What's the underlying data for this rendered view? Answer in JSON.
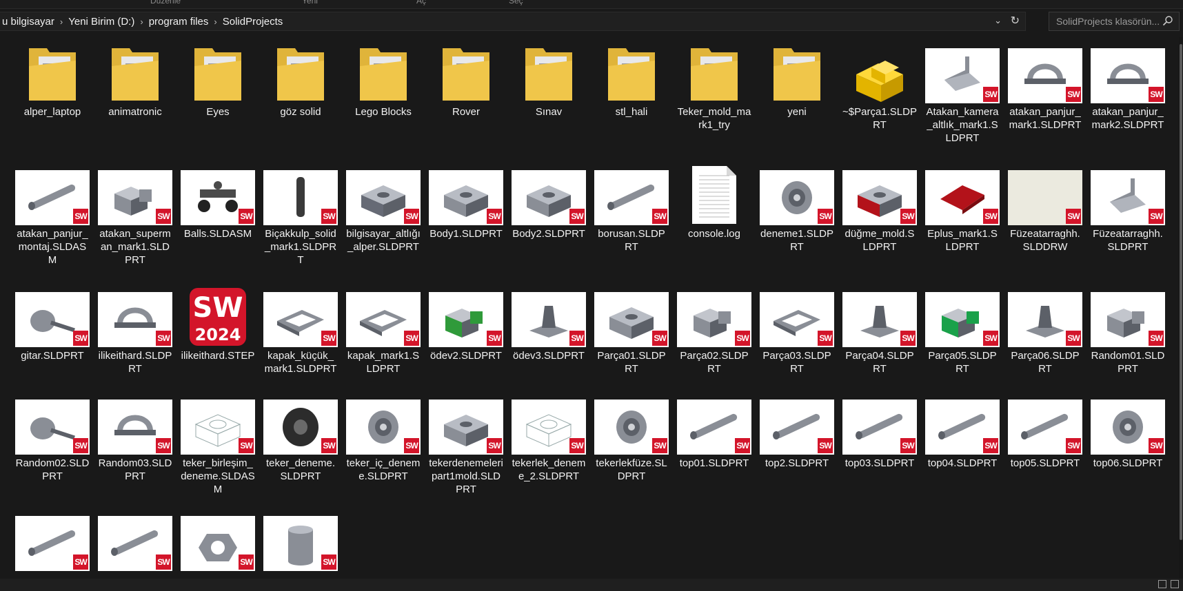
{
  "ribbon": {
    "labels": [
      "Düzenle",
      "Yeni",
      "Aç",
      "Seç"
    ]
  },
  "breadcrumb": [
    "u bilgisayar",
    "Yeni Birim (D:)",
    "program files",
    "SolidProjects"
  ],
  "search": {
    "placeholder": "SolidProjects klasörün..."
  },
  "items": [
    {
      "name": "alper_laptop",
      "kind": "folder"
    },
    {
      "name": "animatronic",
      "kind": "folder"
    },
    {
      "name": "Eyes",
      "kind": "folder"
    },
    {
      "name": "göz solid",
      "kind": "folder"
    },
    {
      "name": "Lego Blocks",
      "kind": "folder"
    },
    {
      "name": "Rover",
      "kind": "folder"
    },
    {
      "name": "Sınav",
      "kind": "folder"
    },
    {
      "name": "stl_hali",
      "kind": "folder"
    },
    {
      "name": "Teker_mold_mark1_try",
      "kind": "folder"
    },
    {
      "name": "yeni",
      "kind": "folder"
    },
    {
      "name": "~$Parça1.SLDPRT",
      "kind": "ghost"
    },
    {
      "name": "Atakan_kamera_altlık_mark1.SLDPRT",
      "kind": "sw",
      "shape": "bracket"
    },
    {
      "name": "atakan_panjur_mark1.SLDPRT",
      "kind": "sw",
      "shape": "clamp"
    },
    {
      "name": "atakan_panjur_mark2.SLDPRT",
      "kind": "sw",
      "shape": "clamp"
    },
    {
      "name": "atakan_panjur_montaj.SLDASM",
      "kind": "sw",
      "shape": "rod"
    },
    {
      "name": "atakan_superman_mark1.SLDPRT",
      "kind": "sw",
      "shape": "block"
    },
    {
      "name": "Balls.SLDASM",
      "kind": "sw",
      "shape": "cart",
      "color": "#4a4a4a"
    },
    {
      "name": "Biçakkulp_solid_mark1.SLDPRT",
      "kind": "sw",
      "shape": "handle",
      "color": "#3a3a3a"
    },
    {
      "name": "bilgisayar_altlığı_alper.SLDPRT",
      "kind": "sw",
      "shape": "box",
      "color": "#666a75"
    },
    {
      "name": "Body1.SLDPRT",
      "kind": "sw",
      "shape": "box"
    },
    {
      "name": "Body2.SLDPRT",
      "kind": "sw",
      "shape": "box"
    },
    {
      "name": "borusan.SLDPRT",
      "kind": "sw",
      "shape": "rod"
    },
    {
      "name": "console.log",
      "kind": "text"
    },
    {
      "name": "deneme1.SLDPRT",
      "kind": "sw",
      "shape": "wheel"
    },
    {
      "name": "düğme_mold.SLDPRT",
      "kind": "sw",
      "shape": "box",
      "color": "#b3121a"
    },
    {
      "name": "Eplus_mark1.SLDPRT",
      "kind": "sw",
      "shape": "diamond",
      "color": "#b3121a"
    },
    {
      "name": "Füzeatarraghh.SLDDRW",
      "kind": "sw",
      "shape": "none",
      "drw": true
    },
    {
      "name": "Füzeatarraghh.SLDPRT",
      "kind": "sw",
      "shape": "bracket"
    },
    {
      "name": "gitar.SLDPRT",
      "kind": "sw",
      "shape": "guitar"
    },
    {
      "name": "ilikeithard.SLDPRT",
      "kind": "sw",
      "shape": "clamp"
    },
    {
      "name": "ilikeithard.STEP",
      "kind": "step",
      "badge_main": "SW",
      "badge_year": "2024"
    },
    {
      "name": "kapak_küçük_mark1.SLDPRT",
      "kind": "sw",
      "shape": "frame"
    },
    {
      "name": "kapak_mark1.SLDPRT",
      "kind": "sw",
      "shape": "frame"
    },
    {
      "name": "ödev2.SLDPRT",
      "kind": "sw",
      "shape": "block",
      "color": "#2f9a3a"
    },
    {
      "name": "ödev3.SLDPRT",
      "kind": "sw",
      "shape": "cone"
    },
    {
      "name": "Parça01.SLDPRT",
      "kind": "sw",
      "shape": "box"
    },
    {
      "name": "Parça02.SLDPRT",
      "kind": "sw",
      "shape": "block"
    },
    {
      "name": "Parça03.SLDPRT",
      "kind": "sw",
      "shape": "frame"
    },
    {
      "name": "Parça04.SLDPRT",
      "kind": "sw",
      "shape": "cone"
    },
    {
      "name": "Parça05.SLDPRT",
      "kind": "sw",
      "shape": "block",
      "color": "#1aa14a"
    },
    {
      "name": "Parça06.SLDPRT",
      "kind": "sw",
      "shape": "cone"
    },
    {
      "name": "Random01.SLDPRT",
      "kind": "sw",
      "shape": "block"
    },
    {
      "name": "Random02.SLDPRT",
      "kind": "sw",
      "shape": "guitar"
    },
    {
      "name": "Random03.SLDPRT",
      "kind": "sw",
      "shape": "clamp"
    },
    {
      "name": "teker_birleşim_deneme.SLDASM",
      "kind": "sw",
      "shape": "wire"
    },
    {
      "name": "teker_deneme.SLDPRT",
      "kind": "sw",
      "shape": "tire",
      "color": "#2c2c2c"
    },
    {
      "name": "teker_iç_deneme.SLDPRT",
      "kind": "sw",
      "shape": "wheel"
    },
    {
      "name": "tekerdenemeleripart1mold.SLDPRT",
      "kind": "sw",
      "shape": "box"
    },
    {
      "name": "tekerlek_deneme_2.SLDPRT",
      "kind": "sw",
      "shape": "wire"
    },
    {
      "name": "tekerlekfüze.SLDPRT",
      "kind": "sw",
      "shape": "wheel"
    },
    {
      "name": "top01.SLDPRT",
      "kind": "sw",
      "shape": "rod"
    },
    {
      "name": "top2.SLDPRT",
      "kind": "sw",
      "shape": "rod"
    },
    {
      "name": "top03.SLDPRT",
      "kind": "sw",
      "shape": "rod"
    },
    {
      "name": "top04.SLDPRT",
      "kind": "sw",
      "shape": "rod"
    },
    {
      "name": "top05.SLDPRT",
      "kind": "sw",
      "shape": "rod"
    },
    {
      "name": "top06.SLDPRT",
      "kind": "sw",
      "shape": "wheel"
    },
    {
      "name": "",
      "kind": "sw",
      "shape": "rod"
    },
    {
      "name": "",
      "kind": "sw",
      "shape": "rod"
    },
    {
      "name": "",
      "kind": "sw",
      "shape": "hex"
    },
    {
      "name": "",
      "kind": "sw",
      "shape": "cyl"
    }
  ],
  "colors": {
    "background": "#191919",
    "sw_badge": "#d3152a",
    "folder": "#f0c64a",
    "part_gray": "#8a8e96"
  }
}
